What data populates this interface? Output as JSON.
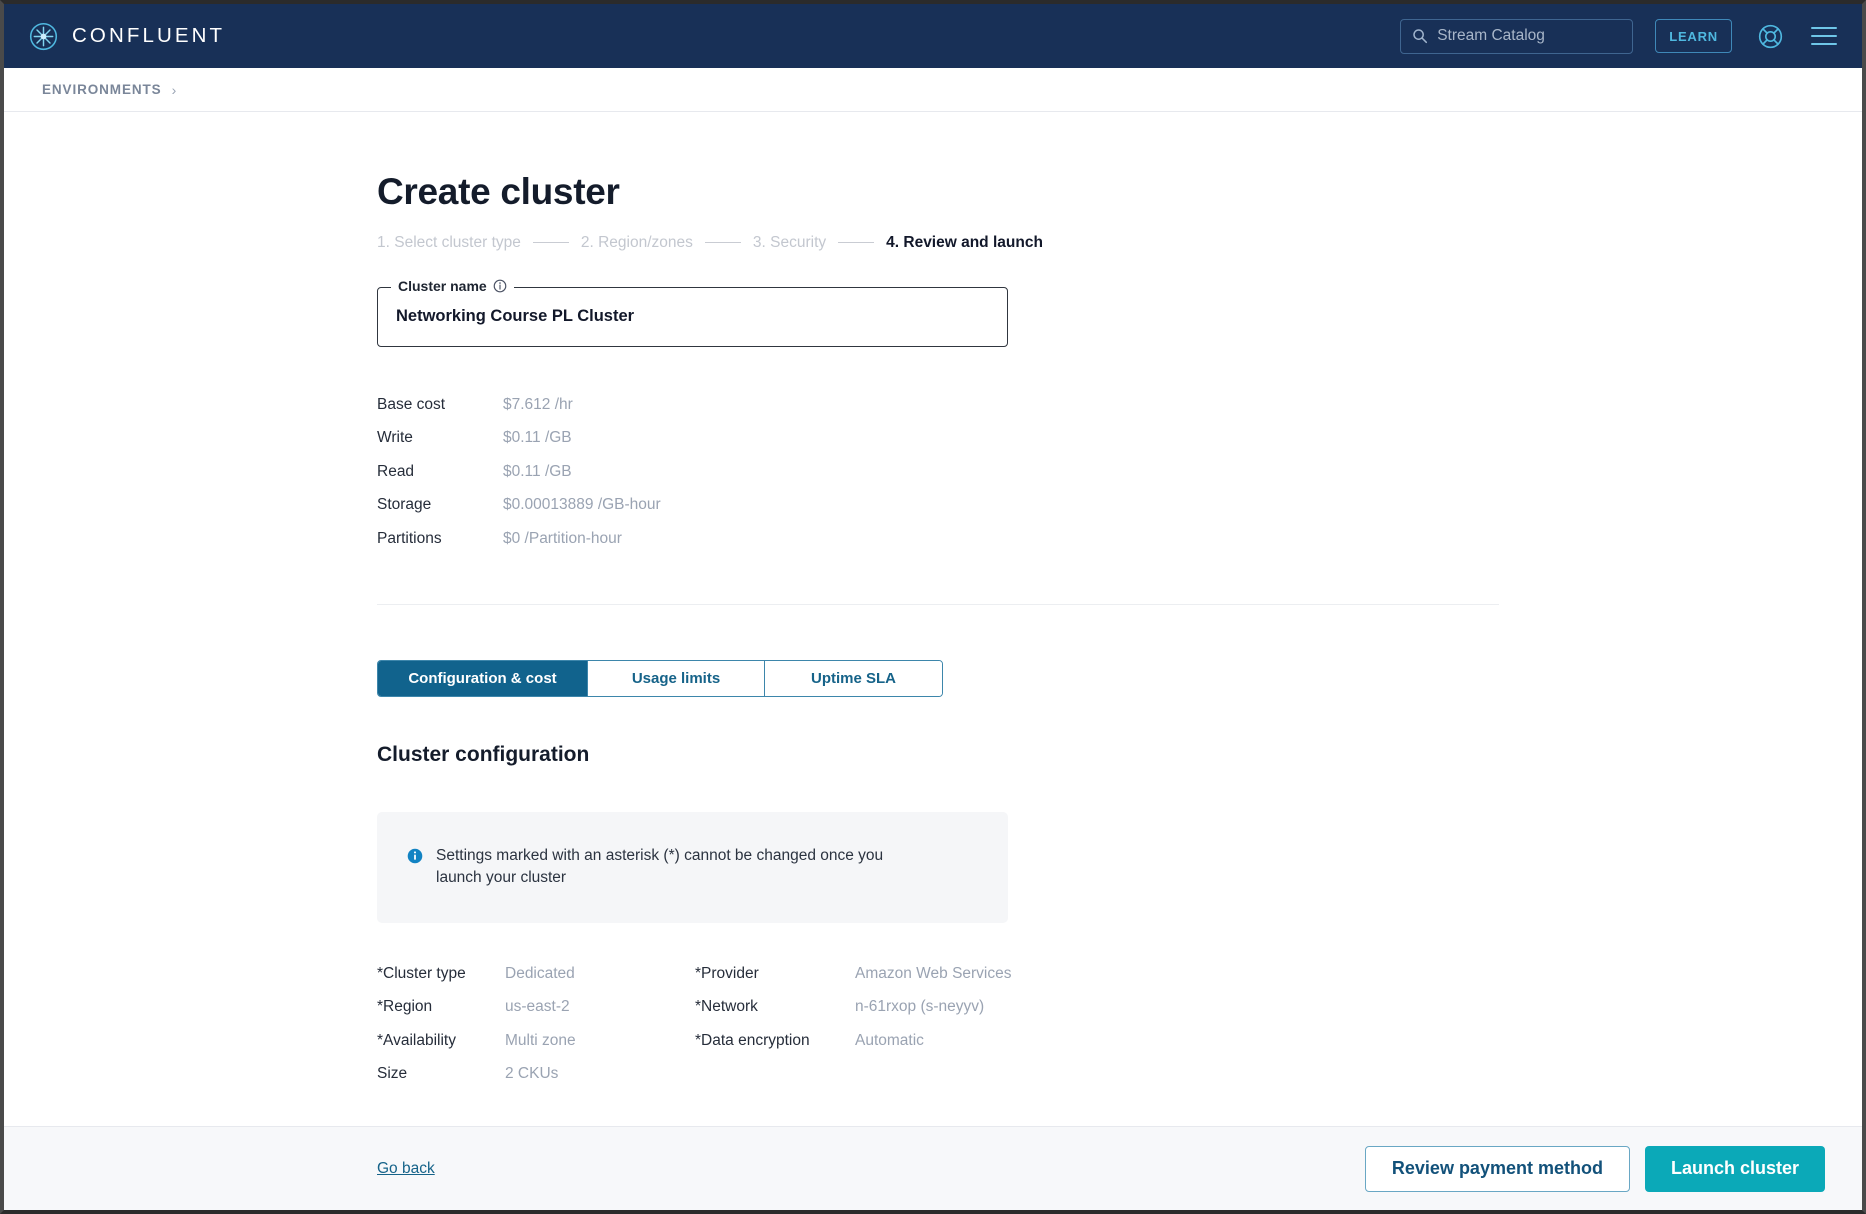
{
  "header": {
    "brand_name": "CONFLUENT",
    "brand_icon": "confluent-logo-icon",
    "search": {
      "icon": "search-icon",
      "placeholder": "Stream Catalog",
      "value": ""
    },
    "learn_label": "LEARN",
    "help_icon": "lifebuoy-help-icon",
    "menu_icon": "hamburger-menu-icon",
    "navy": "#183057"
  },
  "breadcrumb": {
    "items": [
      {
        "label": "ENVIRONMENTS"
      }
    ],
    "separator": "›"
  },
  "page": {
    "title": "Create cluster",
    "steps": [
      {
        "label": "1. Select cluster type",
        "active": false
      },
      {
        "label": "2. Region/zones",
        "active": false
      },
      {
        "label": "3. Security",
        "active": false
      },
      {
        "label": "4. Review and launch",
        "active": true
      }
    ]
  },
  "cluster_name": {
    "legend": "Cluster name",
    "info_icon": "info-outline-icon",
    "value": "Networking Course PL Cluster",
    "placeholder": "Cluster name"
  },
  "pricing": {
    "rows": [
      {
        "label": "Base cost",
        "value": "$7.612 /hr"
      },
      {
        "label": "Write",
        "value": "$0.11 /GB"
      },
      {
        "label": "Read",
        "value": "$0.11 /GB"
      },
      {
        "label": "Storage",
        "value": "$0.00013889 /GB-hour"
      },
      {
        "label": "Partitions",
        "value": "$0 /Partition-hour"
      }
    ]
  },
  "tabs": {
    "items": [
      {
        "label": "Configuration & cost",
        "selected": true
      },
      {
        "label": "Usage limits",
        "selected": false
      },
      {
        "label": "Uptime SLA",
        "selected": false
      }
    ],
    "active_bg": "#11638d",
    "text_color": "#166389"
  },
  "configuration": {
    "section_title": "Cluster configuration",
    "banner": {
      "icon": "info-filled-icon",
      "text": "Settings marked with an asterisk (*) cannot be changed once you launch your cluster",
      "bg": "#f5f6f8"
    },
    "left_column": [
      {
        "label": "*Cluster type",
        "value": "Dedicated"
      },
      {
        "label": "*Region",
        "value": "us-east-2"
      },
      {
        "label": "*Availability",
        "value": "Multi zone"
      },
      {
        "label": "Size",
        "value": "2 CKUs"
      }
    ],
    "right_column": [
      {
        "label": "*Provider",
        "value": "Amazon Web Services"
      },
      {
        "label": "*Network",
        "value": "n-61rxop (s-neyyv)"
      },
      {
        "label": "*Data encryption",
        "value": "Automatic"
      },
      {
        "label": "",
        "value": ""
      }
    ]
  },
  "footer": {
    "go_back_label": "Go back",
    "review_payment_label": "Review payment method",
    "launch_label": "Launch cluster",
    "primary_color": "#0ba9b8"
  }
}
